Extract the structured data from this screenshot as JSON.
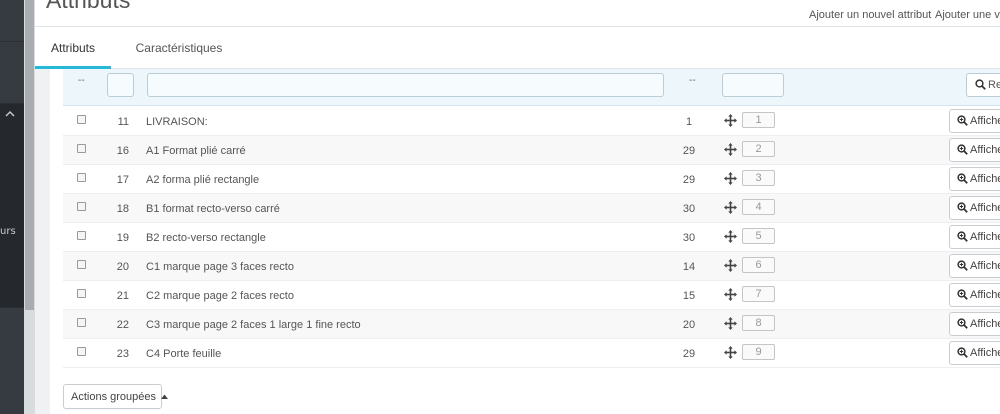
{
  "page": {
    "title": "Attributs"
  },
  "toolbar": {
    "add_attribute": "Ajouter un nouvel attribut",
    "add_value": "Ajouter une val"
  },
  "sidebar": {
    "label": "urs"
  },
  "tabs": [
    {
      "label": "Attributs",
      "active": true
    },
    {
      "label": "Caractéristiques",
      "active": false
    }
  ],
  "filters": {
    "dash_left": "--",
    "dash_right": "--",
    "search_label": "Reche"
  },
  "table": {
    "rows": [
      {
        "id": "11",
        "name": "LIVRAISON:",
        "count": "1",
        "position": "1"
      },
      {
        "id": "16",
        "name": "A1 Format plié carré",
        "count": "29",
        "position": "2"
      },
      {
        "id": "17",
        "name": "A2 forma plié rectangle",
        "count": "29",
        "position": "3"
      },
      {
        "id": "18",
        "name": "B1 format recto-verso carré",
        "count": "30",
        "position": "4"
      },
      {
        "id": "19",
        "name": "B2 recto-verso rectangle",
        "count": "30",
        "position": "5"
      },
      {
        "id": "20",
        "name": "C1 marque page 3 faces recto",
        "count": "14",
        "position": "6"
      },
      {
        "id": "21",
        "name": "C2 marque page 2 faces recto",
        "count": "15",
        "position": "7"
      },
      {
        "id": "22",
        "name": "C3 marque page 2 faces 1 large 1 fine recto",
        "count": "20",
        "position": "8"
      },
      {
        "id": "23",
        "name": "C4 Porte feuille",
        "count": "29",
        "position": "9"
      }
    ],
    "view_label": "Affiche"
  },
  "bulk": {
    "label": "Actions groupées"
  },
  "colors": {
    "accent": "#25b9d7",
    "sidebar": "#363a41"
  }
}
